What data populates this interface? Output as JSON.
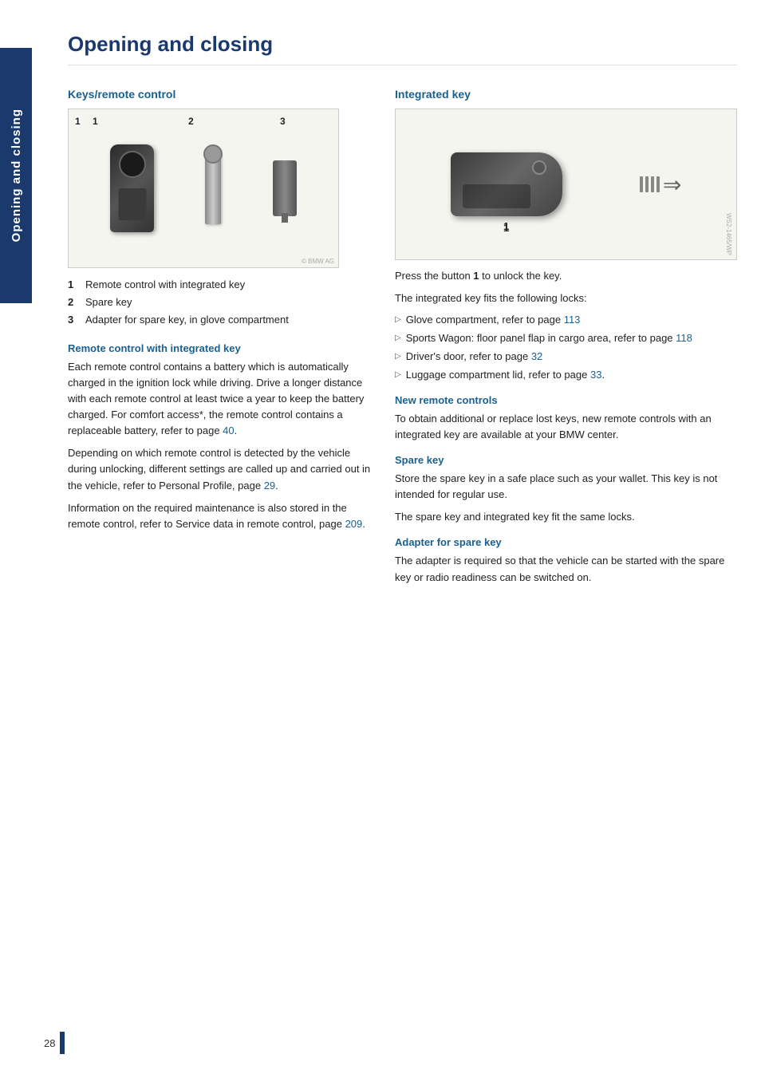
{
  "page": {
    "title": "Opening and closing",
    "sidebar_label": "Opening and closing",
    "page_number": "28"
  },
  "left_section": {
    "heading": "Keys/remote control",
    "image_numbers": [
      "1",
      "2",
      "3"
    ],
    "items": [
      {
        "num": "1",
        "text": "Remote control with integrated key"
      },
      {
        "num": "2",
        "text": "Spare key"
      },
      {
        "num": "3",
        "text": "Adapter for spare key, in glove compartment"
      }
    ],
    "sub_heading_1": "Remote control with integrated key",
    "para_1": "Each remote control contains a battery which is automatically charged in the ignition lock while driving. Drive a longer distance with each remote control at least twice a year to keep the battery charged. For comfort access*, the remote control contains a replaceable battery, refer to page ",
    "link_1": "40",
    "para_1_suffix": ".",
    "para_2": "Depending on which remote control is detected by the vehicle during unlocking, different settings are called up and carried out in the vehicle, refer to Personal Profile, page ",
    "link_2": "29",
    "para_2_suffix": ".",
    "para_3": "Information on the required maintenance is also stored in the remote control, refer to Service data in remote control, page ",
    "link_3": "209",
    "para_3_suffix": "."
  },
  "right_section": {
    "heading_integrated": "Integrated key",
    "image_number_1": "1",
    "press_text": "Press the button ",
    "press_bold": "1",
    "press_text_2": " to unlock the key.",
    "fits_text": "The integrated key fits the following locks:",
    "bullet_items": [
      {
        "text": "Glove compartment, refer to page ",
        "link": "113",
        "suffix": ""
      },
      {
        "text": "Sports Wagon: floor panel flap in cargo area, refer to page ",
        "link": "118",
        "suffix": ""
      },
      {
        "text": "Driver's door, refer to page ",
        "link": "32",
        "suffix": ""
      },
      {
        "text": "Luggage compartment lid, refer to page ",
        "link": "33",
        "suffix": "."
      }
    ],
    "heading_new_remote": "New remote controls",
    "new_remote_text": "To obtain additional or replace lost keys, new remote controls with an integrated key are available at your BMW center.",
    "heading_spare": "Spare key",
    "spare_text_1": "Store the spare key in a safe place such as your wallet. This key is not intended for regular use.",
    "spare_text_2": "The spare key and integrated key fit the same locks.",
    "heading_adapter": "Adapter for spare key",
    "adapter_text": "The adapter is required so that the vehicle can be started with the spare key or radio readiness can be switched on."
  },
  "colors": {
    "heading_blue": "#1a3a6e",
    "sub_heading_teal": "#1a6090",
    "sidebar_bg": "#1a3a6e",
    "link": "#1a6090"
  }
}
